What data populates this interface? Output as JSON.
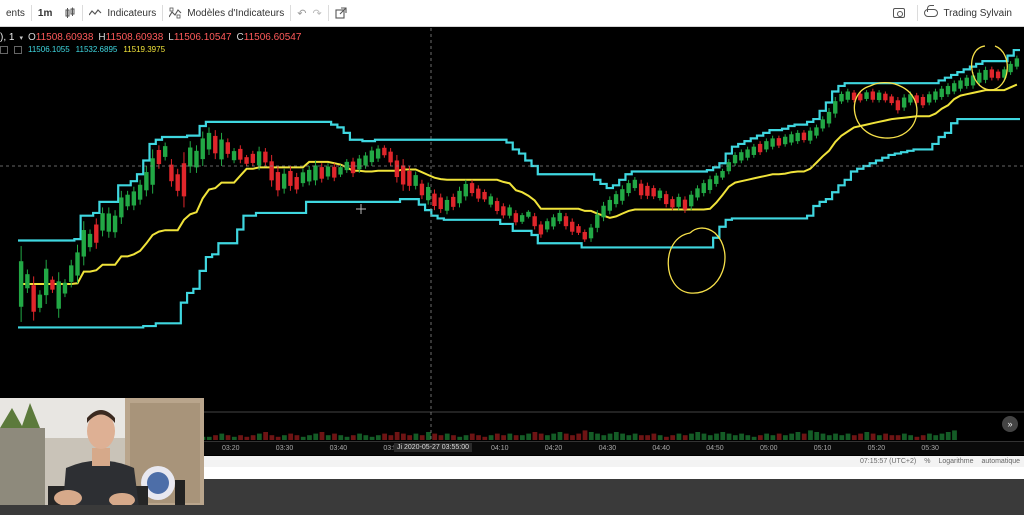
{
  "toolbar": {
    "left_partial": "ents",
    "interval": "1m",
    "indicators_label": "Indicateurs",
    "templates_label": "Modèles d'Indicateurs",
    "account_label": "Trading Sylvain"
  },
  "legend": {
    "symbol_partial": "), 1",
    "open_key": "O",
    "open_val": "11508.60938",
    "high_key": "H",
    "high_val": "11508.60938",
    "low_key": "L",
    "low_val": "11506.10547",
    "close_key": "C",
    "close_val": "11506.60547",
    "ind_val_1": "11506.1055",
    "ind_val_2": "11532.6895",
    "ind_val_3": "11519.3975"
  },
  "time_axis": {
    "labels": [
      "03:20",
      "03:30",
      "03:40",
      "03:50",
      "04:00",
      "04:10",
      "04:20",
      "04:30",
      "04:40",
      "04:50",
      "05:00",
      "05:10",
      "05:20",
      "05:30"
    ],
    "crosshair": "Ji 2020-05-27 03:55:00"
  },
  "status": {
    "time": "07:15:57 (UTC+2)",
    "percent": "%",
    "log": "Logarithme",
    "auto": "automatique"
  },
  "colors": {
    "channel": "#3fd7e0",
    "midline": "#f0e33a",
    "candle_up": "#22a845",
    "candle_down": "#e0262b",
    "annotation": "#f6e04a"
  },
  "chart_data": {
    "type": "candlestick",
    "indicator": "Donchian Channels",
    "candles": [
      [
        92,
        37,
        1
      ],
      [
        75,
        58,
        1
      ],
      [
        70,
        38,
        0
      ],
      [
        60,
        44,
        1
      ],
      [
        82,
        50,
        1
      ],
      [
        70,
        58,
        0
      ],
      [
        73,
        40,
        1
      ],
      [
        68,
        55,
        1
      ],
      [
        82,
        62,
        1
      ],
      [
        93,
        65,
        1
      ],
      [
        110,
        78,
        1
      ],
      [
        104,
        88,
        1
      ],
      [
        112,
        90,
        0
      ],
      [
        120,
        99,
        1
      ],
      [
        120,
        98,
        1
      ],
      [
        118,
        98,
        1
      ],
      [
        132,
        108,
        1
      ],
      [
        132,
        118,
        1
      ],
      [
        135,
        118,
        1
      ],
      [
        140,
        122,
        1
      ],
      [
        150,
        128,
        1
      ],
      [
        162,
        130,
        1
      ],
      [
        165,
        148,
        0
      ],
      [
        167,
        154,
        1
      ],
      [
        155,
        135,
        0
      ],
      [
        148,
        128,
        0
      ],
      [
        160,
        120,
        0
      ],
      [
        168,
        145,
        1
      ],
      [
        165,
        145,
        1
      ],
      [
        175,
        150,
        1
      ],
      [
        178,
        158,
        1
      ],
      [
        176,
        155,
        0
      ],
      [
        174,
        150,
        1
      ],
      [
        170,
        156,
        0
      ],
      [
        163,
        152,
        1
      ],
      [
        165,
        152,
        0
      ],
      [
        158,
        150,
        0
      ],
      [
        161,
        150,
        0
      ],
      [
        164,
        147,
        1
      ],
      [
        163,
        150,
        0
      ],
      [
        158,
        135,
        0
      ],
      [
        150,
        128,
        0
      ],
      [
        148,
        130,
        1
      ],
      [
        150,
        132,
        0
      ],
      [
        145,
        130,
        0
      ],
      [
        148,
        135,
        1
      ],
      [
        150,
        136,
        1
      ],
      [
        154,
        136,
        1
      ],
      [
        152,
        138,
        0
      ],
      [
        152,
        140,
        1
      ],
      [
        152,
        139,
        0
      ],
      [
        151,
        142,
        1
      ],
      [
        155,
        145,
        1
      ],
      [
        156,
        142,
        0
      ],
      [
        158,
        145,
        1
      ],
      [
        160,
        148,
        1
      ],
      [
        164,
        150,
        1
      ],
      [
        165,
        153,
        1
      ],
      [
        165,
        156,
        0
      ],
      [
        163,
        150,
        0
      ],
      [
        158,
        138,
        0
      ],
      [
        155,
        132,
        0
      ],
      [
        150,
        132,
        0
      ],
      [
        146,
        133,
        1
      ],
      [
        140,
        126,
        0
      ],
      [
        138,
        122,
        1
      ],
      [
        133,
        118,
        0
      ],
      [
        130,
        116,
        0
      ],
      [
        128,
        115,
        1
      ],
      [
        130,
        118,
        0
      ],
      [
        135,
        120,
        1
      ],
      [
        140,
        125,
        1
      ],
      [
        140,
        128,
        0
      ],
      [
        136,
        124,
        0
      ],
      [
        133,
        124,
        0
      ],
      [
        130,
        120,
        1
      ],
      [
        127,
        115,
        0
      ],
      [
        123,
        112,
        0
      ],
      [
        122,
        112,
        1
      ],
      [
        118,
        107,
        0
      ],
      [
        116,
        108,
        1
      ],
      [
        118,
        112,
        1
      ],
      [
        116,
        104,
        0
      ],
      [
        110,
        98,
        0
      ],
      [
        112,
        102,
        1
      ],
      [
        115,
        104,
        1
      ],
      [
        118,
        108,
        1
      ],
      [
        116,
        104,
        0
      ],
      [
        112,
        100,
        0
      ],
      [
        108,
        100,
        0
      ],
      [
        104,
        95,
        0
      ],
      [
        108,
        95,
        1
      ],
      [
        118,
        102,
        1
      ],
      [
        124,
        110,
        1
      ],
      [
        128,
        115,
        1
      ],
      [
        132,
        120,
        1
      ],
      [
        136,
        122,
        1
      ],
      [
        140,
        128,
        1
      ],
      [
        142,
        132,
        1
      ],
      [
        140,
        126,
        0
      ],
      [
        138,
        126,
        0
      ],
      [
        136,
        126,
        0
      ],
      [
        134,
        125,
        1
      ],
      [
        132,
        120,
        0
      ],
      [
        128,
        118,
        0
      ],
      [
        130,
        118,
        1
      ],
      [
        128,
        116,
        0
      ],
      [
        132,
        118,
        1
      ],
      [
        136,
        125,
        1
      ],
      [
        140,
        128,
        1
      ],
      [
        143,
        130,
        1
      ],
      [
        145,
        135,
        1
      ],
      [
        148,
        140,
        1
      ],
      [
        155,
        144,
        1
      ],
      [
        160,
        150,
        1
      ],
      [
        162,
        152,
        1
      ],
      [
        164,
        154,
        1
      ],
      [
        166,
        156,
        1
      ],
      [
        168,
        158,
        0
      ],
      [
        170,
        160,
        1
      ],
      [
        172,
        162,
        1
      ],
      [
        172,
        163,
        0
      ],
      [
        173,
        164,
        1
      ],
      [
        175,
        165,
        1
      ],
      [
        176,
        166,
        1
      ],
      [
        176,
        167,
        0
      ],
      [
        178,
        166,
        1
      ],
      [
        180,
        170,
        1
      ],
      [
        186,
        175,
        1
      ],
      [
        192,
        178,
        1
      ],
      [
        200,
        185,
        1
      ],
      [
        204,
        195,
        1
      ],
      [
        206,
        196,
        1
      ],
      [
        205,
        196,
        0
      ],
      [
        204,
        196,
        0
      ],
      [
        205,
        197,
        1
      ],
      [
        206,
        196,
        0
      ],
      [
        205,
        196,
        1
      ],
      [
        204,
        196,
        0
      ],
      [
        202,
        194,
        0
      ],
      [
        200,
        188,
        0
      ],
      [
        202,
        190,
        1
      ],
      [
        204,
        194,
        1
      ],
      [
        203,
        194,
        0
      ],
      [
        202,
        192,
        0
      ],
      [
        204,
        194,
        1
      ],
      [
        206,
        196,
        1
      ],
      [
        208,
        198,
        1
      ],
      [
        210,
        200,
        1
      ],
      [
        212,
        202,
        1
      ],
      [
        214,
        204,
        1
      ],
      [
        216,
        206,
        1
      ],
      [
        218,
        206,
        1
      ],
      [
        220,
        208,
        1
      ],
      [
        222,
        210,
        1
      ],
      [
        222,
        212,
        0
      ],
      [
        220,
        212,
        0
      ],
      [
        222,
        212,
        1
      ],
      [
        226,
        216,
        1
      ],
      [
        230,
        220,
        1
      ]
    ],
    "volumes": [
      2,
      3,
      2,
      4,
      3,
      2,
      3,
      5,
      3,
      2,
      4,
      3,
      2,
      3,
      4,
      5,
      2,
      3,
      3,
      4,
      2,
      3,
      5,
      4,
      3,
      2,
      3,
      4,
      3,
      2,
      2,
      3,
      4,
      3,
      2,
      3,
      2,
      3,
      4,
      5,
      3,
      2,
      3,
      4,
      3,
      2,
      3,
      4,
      5,
      3,
      4,
      3,
      2,
      3,
      4,
      3,
      2,
      3,
      4,
      3,
      5,
      4,
      3,
      4,
      3,
      5,
      4,
      3,
      4,
      3,
      2,
      3,
      4,
      3,
      2,
      3,
      4,
      3,
      4,
      3,
      3,
      4,
      5,
      4,
      3,
      4,
      5,
      4,
      3,
      4,
      6,
      5,
      4,
      3,
      4,
      5,
      4,
      3,
      4,
      3,
      3,
      4,
      3,
      2,
      3,
      4,
      3,
      4,
      5,
      4,
      3,
      4,
      5,
      4,
      3,
      4,
      3,
      2,
      3,
      4,
      3,
      4,
      3,
      4,
      5,
      4,
      6,
      5,
      4,
      3,
      4,
      3,
      4,
      3,
      4,
      5,
      4,
      3,
      4,
      3,
      3,
      4,
      3,
      2,
      3,
      4,
      3,
      4,
      5,
      6
    ]
  }
}
